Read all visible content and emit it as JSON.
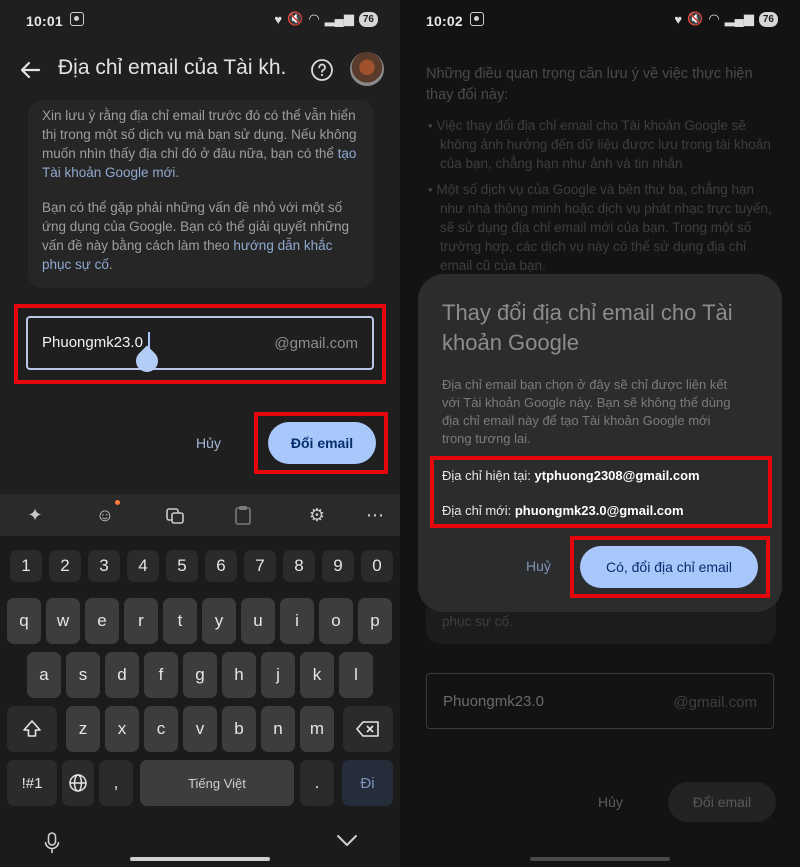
{
  "colors": {
    "highlight": "#e5050f",
    "primary_button": "#a8c7fa",
    "link": "#8fa9cf"
  },
  "left": {
    "status": {
      "time": "10:01",
      "battery": "76"
    },
    "title": "Địa chỉ email của Tài kh...",
    "icons": [
      "back-arrow-icon",
      "help-icon"
    ],
    "info_p1_lines": [
      "Xin lưu ý rằng địa chỉ email trước đó có thể vẫn hiển",
      "thị trong một số dịch vụ mà bạn sử dụng. Nếu không",
      "muốn nhìn thấy địa chỉ đó ở đâu nữa, bạn có thể"
    ],
    "info_p1_link_a": "tạo",
    "info_p1_link_b": "Tài khoản Google mới",
    "info_p2_lines": [
      "Bạn có thể gặp phải những vấn đề nhỏ với một số",
      "ứng dụng của Google. Bạn có thể giải quyết những",
      "vấn đề này bằng cách làm theo"
    ],
    "info_p2_link_a": "hướng dẫn khắc",
    "info_p2_link_b": "phục sự cố",
    "email_value": "Phuongmk23.0",
    "email_suffix": "@gmail.com",
    "cancel": "Hủy",
    "submit": "Đổi email",
    "keyboard": {
      "toolbar_icons": [
        "sparkle-icon",
        "emoji-icon",
        "translate-icon",
        "clipboard-icon",
        "settings-icon",
        "more-icon"
      ],
      "row1": [
        "1",
        "2",
        "3",
        "4",
        "5",
        "6",
        "7",
        "8",
        "9",
        "0"
      ],
      "row2": [
        "q",
        "w",
        "e",
        "r",
        "t",
        "y",
        "u",
        "i",
        "o",
        "p"
      ],
      "row3": [
        "a",
        "s",
        "d",
        "f",
        "g",
        "h",
        "j",
        "k",
        "l"
      ],
      "row4": [
        "z",
        "x",
        "c",
        "v",
        "b",
        "n",
        "m"
      ],
      "symbols": "!#1",
      "comma": ",",
      "space": "Tiếng Việt",
      "period": ".",
      "enter": "Đi"
    }
  },
  "right": {
    "status": {
      "time": "10:02",
      "battery": "76"
    },
    "bg_intro": [
      "Những điều quan trọng cần lưu ý về việc thực hiện",
      "thay đổi này:"
    ],
    "bg_bullet1": [
      "Việc thay đổi địa chỉ email cho Tài khoản Google sẽ",
      "không ảnh hưởng đến dữ liệu được lưu trong tài khoản",
      "của bạn, chẳng hạn như ảnh và tin nhắn"
    ],
    "bg_bullet2": [
      "Một số dịch vụ của Google và bên thứ ba, chẳng hạn",
      "như nhà thông minh hoặc dịch vụ phát nhạc trực tuyến,",
      "sẽ sử dụng địa chỉ email mới của bạn. Trong một số",
      "trường hợp, các dịch vụ này có thể sử dụng địa chỉ",
      "email cũ của bạn."
    ],
    "bg_tail": "phục sự cố.",
    "bg_input_value": "Phuongmk23.0",
    "bg_input_suffix": "@gmail.com",
    "bg_cancel": "Hủy",
    "bg_submit": "Đổi email",
    "dialog": {
      "title_lines": [
        "Thay đổi địa chỉ email cho Tài",
        "khoản Google"
      ],
      "body_lines": [
        "Địa chỉ email bạn chọn ở đây sẽ chỉ được liên kết",
        "với Tài khoản Google này. Bạn sẽ không thể dùng",
        "địa chỉ email này để tạo Tài khoản Google mới",
        "trong tương lai."
      ],
      "current_label": "Địa chỉ hiện tại:",
      "current_value": "ytphuong2308@gmail.com",
      "new_label": "Địa chỉ mới:",
      "new_value": "phuongmk23.0@gmail.com",
      "cancel": "Huỷ",
      "confirm": "Có, đổi địa chỉ email"
    }
  }
}
